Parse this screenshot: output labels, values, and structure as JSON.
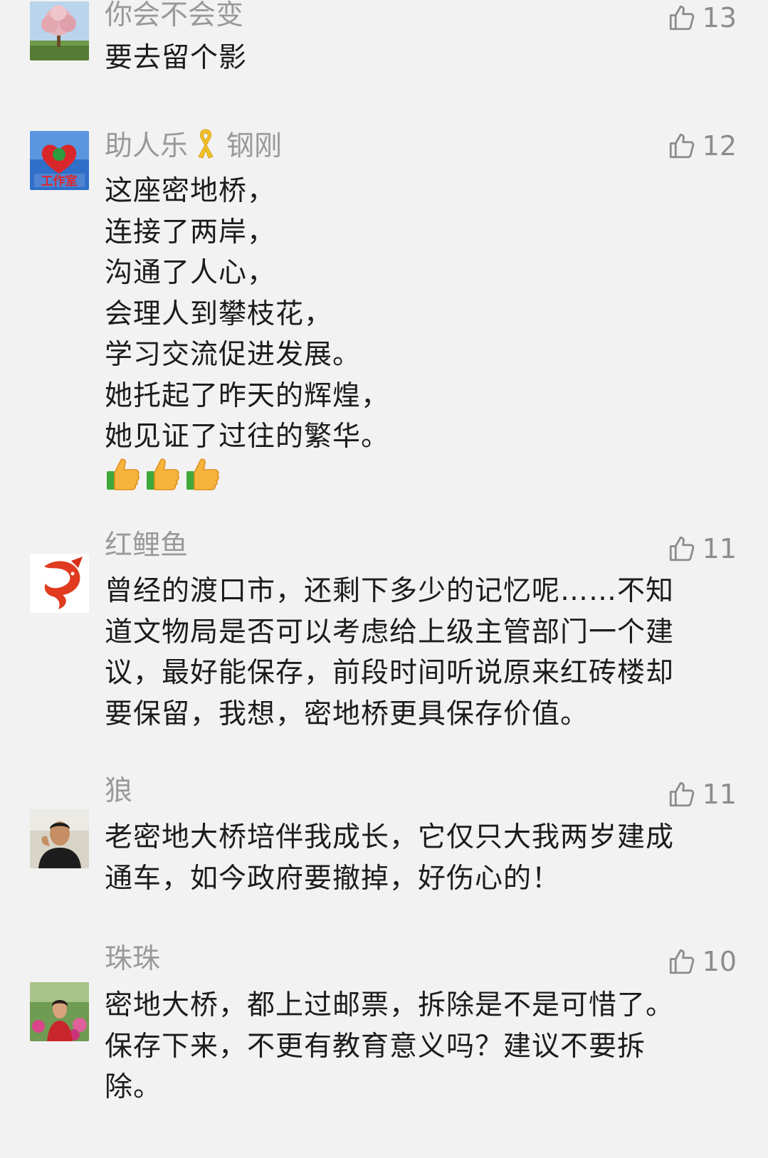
{
  "comments": [
    {
      "username": "你会不会变",
      "likes": "13",
      "lines": [
        "要去留个影"
      ]
    },
    {
      "username": "助人乐",
      "username_suffix": "钢刚",
      "likes": "12",
      "lines": [
        "这座密地桥，",
        "连接了两岸，",
        "沟通了人心，",
        "会理人到攀枝花，",
        "学习交流促进发展。",
        "她托起了昨天的辉煌，",
        "她见证了过往的繁华。"
      ],
      "avatar_text": "工作室"
    },
    {
      "username": "红鲤鱼",
      "likes": "11",
      "lines": [
        "曾经的渡口市，还剩下多少的记忆呢……不知",
        "道文物局是否可以考虑给上级主管部门一个建",
        "议，最好能保存，前段时间听说原来红砖楼却",
        "要保留，我想，密地桥更具保存价值。"
      ]
    },
    {
      "username": "狼",
      "likes": "11",
      "lines": [
        "老密地大桥培伴我成长，它仅只大我两岁建成",
        "通车，如今政府要撤掉，好伤心的！"
      ]
    },
    {
      "username": "珠珠",
      "likes": "10",
      "lines": [
        "密地大桥，都上过邮票，拆除是不是可惜了。",
        "保存下来，不更有教育意义吗？建议不要拆",
        "除。"
      ]
    }
  ],
  "colors": {
    "background": "#f2f2f2",
    "username": "#999999",
    "text": "#1c1c1c",
    "like_icon": "#8c8c8c"
  }
}
